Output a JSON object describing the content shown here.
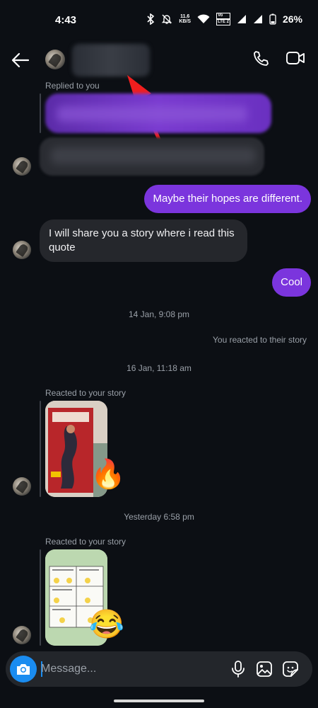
{
  "status_bar": {
    "time": "4:43",
    "net_speed_value": "11.6",
    "net_speed_unit": "KB/S",
    "volte_top": "Vo",
    "volte_bottom": "LTE 2",
    "battery": "26%",
    "icons": [
      "bluetooth-icon",
      "mute-bell-icon",
      "wifi-icon",
      "signal-icon",
      "signal-icon",
      "battery-icon"
    ]
  },
  "header": {
    "back_icon": "arrow-left-icon",
    "call_icon": "phone-icon",
    "video_icon": "video-camera-icon"
  },
  "messages": {
    "replied_label": "Replied to you",
    "outgoing_1": "Maybe their hopes are different.",
    "incoming_1": "I will share you a story where i read this quote",
    "outgoing_2": "Cool",
    "timestamp_1": "14 Jan, 9:08 pm",
    "reacted_note": "You reacted to their story",
    "timestamp_2": "16 Jan, 11:18 am",
    "story_label_1": "Reacted to your story",
    "story_reaction_1": "🔥",
    "timestamp_3": "Yesterday 6:58 pm",
    "story_label_2": "Reacted to your story",
    "story_reaction_2": "😂"
  },
  "composer": {
    "placeholder": "Message...",
    "camera_icon": "camera-icon",
    "mic_icon": "microphone-icon",
    "gallery_icon": "image-icon",
    "sticker_icon": "sticker-icon"
  },
  "colors": {
    "background": "#0c0f14",
    "outgoing_bubble": "#7b35dd",
    "incoming_bubble": "#25272c",
    "accent": "#1a8cf0",
    "annotation_arrow": "#f01e1e"
  }
}
